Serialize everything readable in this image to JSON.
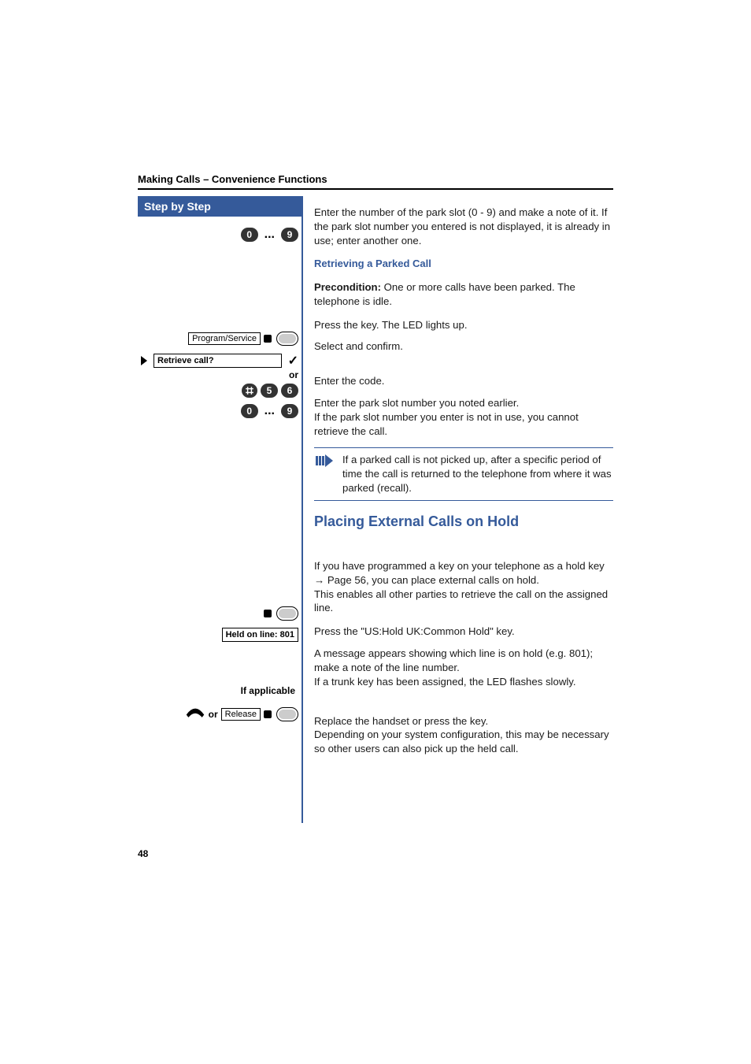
{
  "header": "Making Calls – Convenience Functions",
  "sidebar": {
    "title": "Step by Step",
    "keys09_a": {
      "k0": "0",
      "k9": "9"
    },
    "program_service": "Program/Service",
    "retrieve_call": "Retrieve call?",
    "or": "or",
    "code": {
      "k5": "5",
      "k6": "6"
    },
    "keys09_b": {
      "k0": "0",
      "k9": "9"
    },
    "held_line": "Held on line: 801",
    "if_applicable": "If applicable",
    "release": "Release"
  },
  "content": {
    "p1": "Enter the number of the park slot (0 - 9) and make a note of it. If the park slot number you entered is not displayed, it is already in use; enter another one.",
    "h_retrieve": "Retrieving a Parked Call",
    "precond_label": "Precondition:",
    "precond_text": " One or more calls have been parked. The telephone is idle.",
    "press_led": "Press the key. The LED lights up.",
    "select_confirm": "Select and confirm.",
    "enter_code": "Enter the code.",
    "park_slot": "Enter the park slot number you noted earlier.\nIf the park slot number you enter is not in use, you cannot retrieve the call.",
    "info_note": "If a parked call is not picked up, after a specific period of time the call is returned to the telephone from where it was parked (recall).",
    "h_placing": "Placing External Calls on Hold",
    "hold_p1a": "If you have programmed a key on your telephone as a hold key ",
    "hold_link": "→ Page 56",
    "hold_p1b": ", you can place external calls on hold.\nThis enables all other parties to retrieve the call on the assigned line.",
    "press_hold": "Press the \"US:Hold UK:Common Hold\" key.",
    "msg_appears": "A message appears showing which line is on hold (e.g. 801); make a note of the line number.\nIf a trunk key has been assigned, the LED flashes slowly.",
    "replace": "Replace the handset or press the key.\nDepending on your system configuration, this may be necessary so other users can also pick up the held call."
  },
  "page_number": "48"
}
